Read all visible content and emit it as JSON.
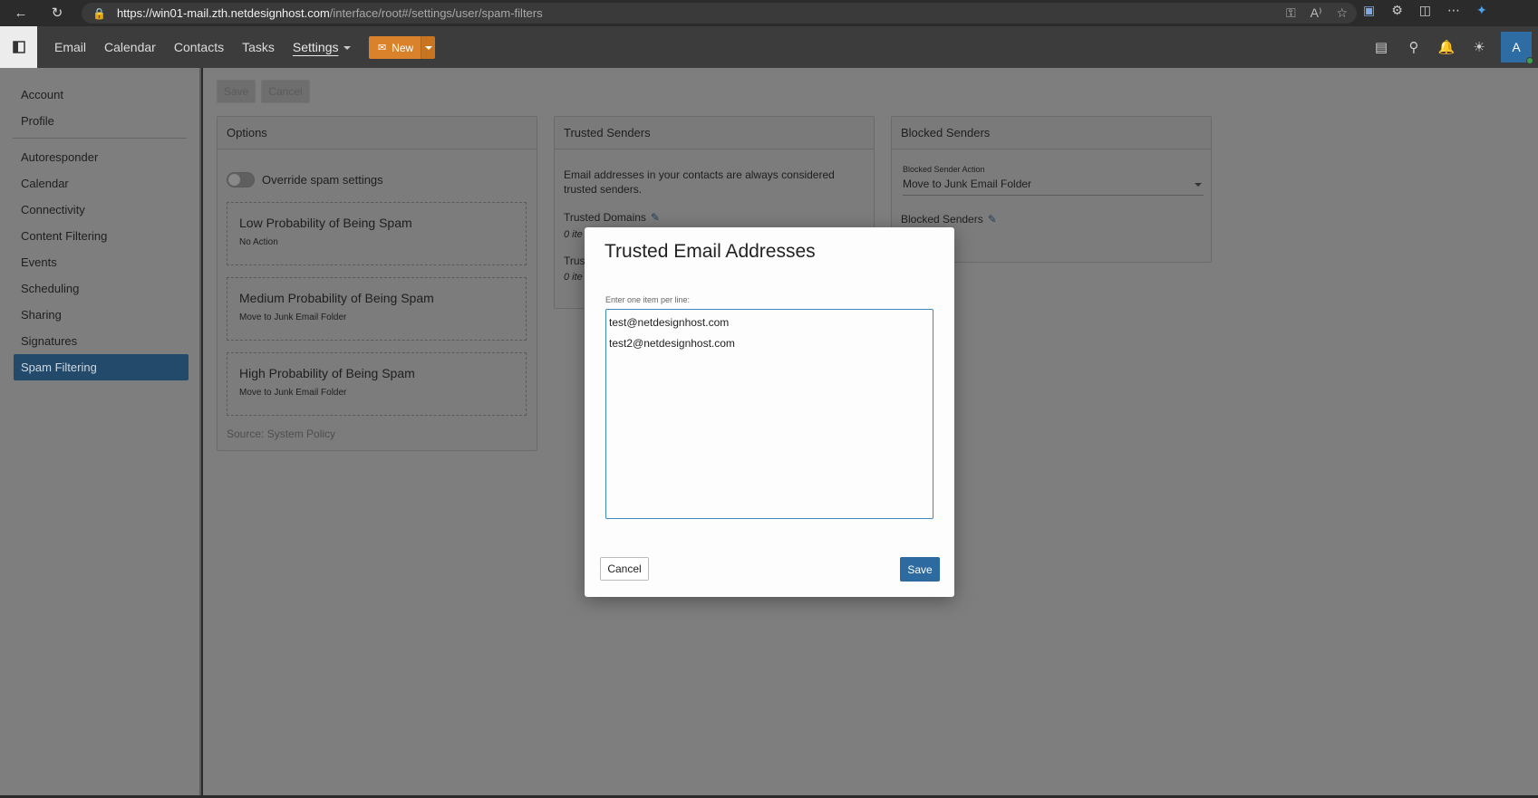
{
  "browser": {
    "url_host": "https://win01-mail.zth.netdesignhost.com",
    "url_path": "/interface/root#/settings/user/spam-filters"
  },
  "nav": {
    "items": [
      "Email",
      "Calendar",
      "Contacts",
      "Tasks"
    ],
    "settings_label": "Settings",
    "new_label": "New"
  },
  "user": {
    "avatar_letter": "A"
  },
  "sidebar": {
    "top_items": [
      "Account",
      "Profile"
    ],
    "items": [
      "Autoresponder",
      "Calendar",
      "Connectivity",
      "Content Filtering",
      "Events",
      "Scheduling",
      "Sharing",
      "Signatures",
      "Spam Filtering"
    ]
  },
  "toolbar": {
    "save_label": "Save",
    "cancel_label": "Cancel"
  },
  "options": {
    "title": "Options",
    "override_label": "Override spam settings",
    "low_title": "Low Probability of Being Spam",
    "low_action": "No Action",
    "medium_title": "Medium Probability of Being Spam",
    "medium_action": "Move to Junk Email Folder",
    "high_title": "High Probability of Being Spam",
    "high_action": "Move to Junk Email Folder",
    "source": "Source: System Policy"
  },
  "trusted": {
    "title": "Trusted Senders",
    "description": "Email addresses in your contacts are always considered trusted senders.",
    "domains_label": "Trusted Domains",
    "domains_count": "0 ite",
    "emails_label": "Trus",
    "emails_count": "0 ite"
  },
  "blocked": {
    "title": "Blocked Senders",
    "action_label": "Blocked Sender Action",
    "action_value": "Move to Junk Email Folder",
    "senders_label": "Blocked Senders"
  },
  "modal": {
    "title": "Trusted Email Addresses",
    "hint": "Enter one item per line:",
    "lines": [
      "test@netdesignhost.com",
      "test2@netdesignhost.com"
    ],
    "cancel_label": "Cancel",
    "save_label": "Save"
  },
  "colors": {
    "accent": "#2c6aa0",
    "new_button": "#d9822b",
    "sidebar_active": "#234a6b"
  }
}
